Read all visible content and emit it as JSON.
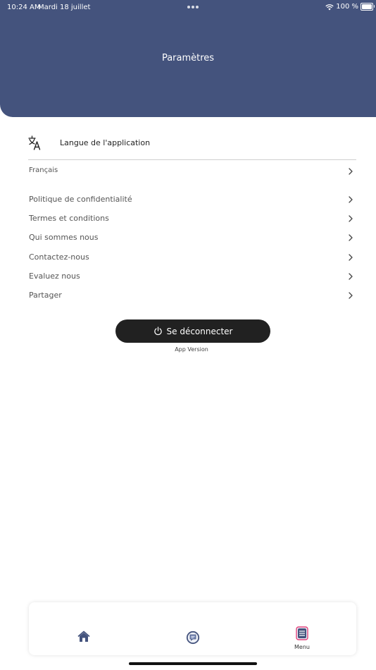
{
  "status_bar": {
    "time": "10:24 AM",
    "date": "Mardi 18 juillet",
    "battery": "100 %"
  },
  "header": {
    "title": "Paramètres"
  },
  "language": {
    "label": "Langue de l'application",
    "current": "Français"
  },
  "menu": {
    "items": [
      {
        "label": "Politique de confidentialité"
      },
      {
        "label": "Termes et conditions"
      },
      {
        "label": "Qui sommes nous"
      },
      {
        "label": "Contactez-nous"
      },
      {
        "label": "Evaluez nous"
      },
      {
        "label": "Partager"
      }
    ]
  },
  "logout": {
    "label": "Se déconnecter"
  },
  "footer": {
    "app_version": "App Version"
  },
  "tab_bar": {
    "active_tab": "menu",
    "menu_label": "Menu"
  },
  "colors": {
    "header_bg": "#44537d",
    "button_bg": "#212121",
    "accent": "#44537d",
    "menu_icon_border": "#e0407a"
  },
  "icons": {
    "language": "translate-icon",
    "chevron": "chevron-right-icon",
    "logout": "power-icon",
    "tab_home": "home-icon",
    "tab_chat": "chat-icon",
    "tab_menu": "menu-list-icon"
  }
}
